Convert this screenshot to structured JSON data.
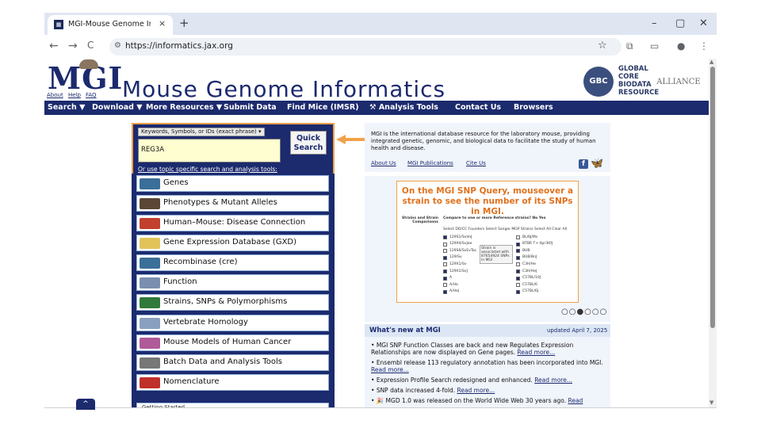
{
  "browser": {
    "tab_title": "MGI-Mouse Genome Informatics",
    "tab_close": "×",
    "new_tab": "+",
    "url": "https://informatics.jax.org",
    "win_minimize": "–",
    "win_restore": "▢",
    "win_close": "✕",
    "back": "←",
    "forward": "→",
    "reload": "C",
    "star": "☆",
    "menu": "⋮"
  },
  "header": {
    "logo": "MGI",
    "links": [
      "About",
      "Help",
      "FAQ"
    ],
    "site_title": "Mouse Genome Informatics",
    "gbc_badge": "GBC",
    "gbc_text": [
      "GLOBAL",
      "CORE",
      "BIODATA",
      "RESOURCE"
    ],
    "alliance": "ALLIANCE"
  },
  "nav": [
    "Search ▼",
    "Download ▼",
    "More Resources ▼",
    "Submit Data",
    "Find Mice (IMSR)",
    "Analysis Tools",
    "Contact Us",
    "Browsers"
  ],
  "search": {
    "select_label": "Keywords, Symbols, or IDs (exact phrase) ▾",
    "query": "REG3A",
    "quick_label": "Quick Search",
    "topic_text": "Or use topic specific search and analysis tools:"
  },
  "topics": [
    {
      "label": "Genes",
      "icon": "genes-icon",
      "color": "#3a6f9a"
    },
    {
      "label": "Phenotypes & Mutant Alleles",
      "icon": "mouse-icon",
      "color": "#5b4636"
    },
    {
      "label": "Human–Mouse: Disease Connection",
      "icon": "human-mouse-icon",
      "color": "#c2402e"
    },
    {
      "label": "Gene Expression Database (GXD)",
      "icon": "embryo-icon",
      "color": "#e2c35a"
    },
    {
      "label": "Recombinase (cre)",
      "icon": "recombinase-icon",
      "color": "#3a6f9a"
    },
    {
      "label": "Function",
      "icon": "function-icon",
      "color": "#7a8fb0"
    },
    {
      "label": "Strains, SNPs & Polymorphisms",
      "icon": "strains-icon",
      "color": "#2f7a3a"
    },
    {
      "label": "Vertebrate Homology",
      "icon": "homology-icon",
      "color": "#8aa0c0"
    },
    {
      "label": "Mouse Models of Human Cancer",
      "icon": "cancer-icon",
      "color": "#b05a9a"
    },
    {
      "label": "Batch Data and Analysis Tools",
      "icon": "tools-icon",
      "color": "#777777"
    },
    {
      "label": "Nomenclature",
      "icon": "nomenclature-icon",
      "color": "#c0302a"
    }
  ],
  "partial_item": "Getting Started",
  "intro": {
    "text": "MGI is the international database resource for the laboratory mouse, providing integrated genetic, genomic, and biological data to facilitate the study of human health and disease.",
    "links": [
      "About Us",
      "MGI Publications",
      "Cite Us"
    ]
  },
  "snp_card": {
    "title": "On the MGI SNP Query, mouseover a strain to see the number of its SNPs in MGI.",
    "row_label": "Strains and Strain Comparisons",
    "compare": "Compare to one or more Reference strains?",
    "options": "No  Yes",
    "columns": "Select DO/CC Founders  Select Sanger MGP Strains  Select All  Clear All",
    "tooltip": "Strain is associated with 87654924 SNPs in MGI",
    "left_strains": [
      "129S1/SvImJ",
      "129X4/SvJae",
      "129S6/SvEvTac",
      "129/Sv",
      "129X1/Sv",
      "129X1/SvJ",
      "A",
      "A/He",
      "A/HeJ"
    ],
    "left_checked": [
      true,
      false,
      false,
      true,
      false,
      true,
      true,
      false,
      true
    ],
    "right_strains": [
      "BL/6J/Ms",
      "BTBR T+ Itpr3tf/J",
      "BUB",
      "BUB/BnJ",
      "C3H/He",
      "C3H/HeJ",
      "C57BL/10J",
      "C57BL/6",
      "C57BL/6J"
    ],
    "right_checked": [
      false,
      true,
      true,
      true,
      false,
      true,
      true,
      false,
      true
    ],
    "dots": "○○●○○○"
  },
  "news": {
    "title": "What's new at MGI",
    "updated": "updated April 7, 2025",
    "items": [
      {
        "text": "MGI SNP Function Classes are back and new Regulates Expression Relationships are now displayed on Gene pages.",
        "link": "Read more..."
      },
      {
        "text": "Ensembl release 113 regulatory annotation has been incorporated into MGI.",
        "link": "Read more..."
      },
      {
        "text": "Expression Profile Search redesigned and enhanced.",
        "link": "Read more..."
      },
      {
        "text": "SNP data increased 4-fold.",
        "link": "Read more..."
      },
      {
        "text": "🎉 MGD 1.0 was released on the World Wide Web 30 years ago.",
        "link": "Read"
      }
    ]
  },
  "up_button": "^",
  "colors": {
    "navy": "#1c2a6e",
    "accent_orange": "#f2a14a"
  }
}
